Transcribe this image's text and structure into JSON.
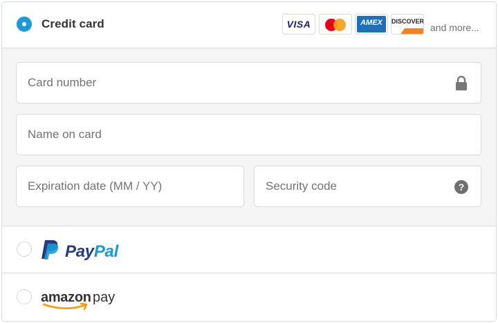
{
  "credit_card": {
    "label": "Credit card",
    "selected": true,
    "brands": {
      "visa": "VISA",
      "mastercard": "Mastercard",
      "amex": "AMEX",
      "discover": "DISCOVER"
    },
    "and_more": "and more..."
  },
  "form": {
    "card_number": {
      "placeholder": "Card number",
      "value": ""
    },
    "name_on_card": {
      "placeholder": "Name on card",
      "value": ""
    },
    "expiration": {
      "placeholder": "Expiration date (MM / YY)",
      "value": ""
    },
    "security_code": {
      "placeholder": "Security code",
      "value": ""
    },
    "help_glyph": "?"
  },
  "paypal": {
    "logo_pay": "Pay",
    "logo_pal": "Pal",
    "selected": false
  },
  "amazon_pay": {
    "logo_amazon": "amazon",
    "logo_pay": "pay",
    "selected": false
  },
  "colors": {
    "accent": "#1c9ad6",
    "paypal_dark": "#253b80",
    "paypal_light": "#179bd7",
    "amazon_orange": "#ff9900"
  }
}
